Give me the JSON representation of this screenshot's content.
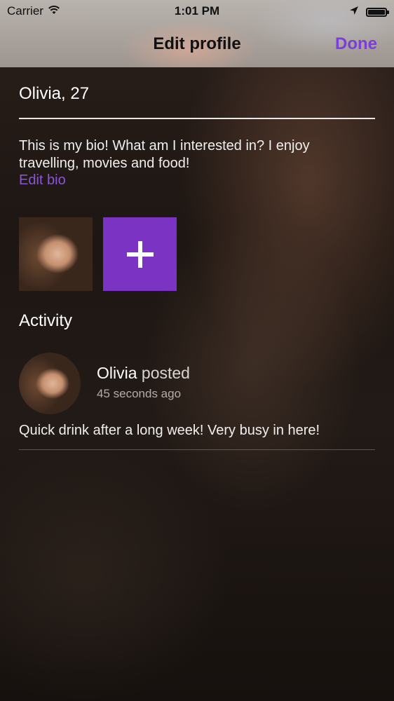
{
  "status_bar": {
    "carrier": "Carrier",
    "time": "1:01 PM"
  },
  "nav": {
    "title": "Edit profile",
    "done_label": "Done"
  },
  "profile": {
    "name_age": "Olivia, 27",
    "bio": "This is my bio! What am I interested in? I enjoy travelling, movies and food!",
    "edit_bio_label": "Edit bio"
  },
  "activity": {
    "title": "Activity",
    "posts": [
      {
        "author": "Olivia",
        "action": "posted",
        "time": "45 seconds ago",
        "text": "Quick drink after a long week! Very busy in here!"
      }
    ]
  },
  "colors": {
    "accent": "#7b33c4",
    "link": "#8a55d8"
  },
  "icons": {
    "status_left": [
      "wifi-icon"
    ],
    "status_right": [
      "location-arrow-icon",
      "battery-icon"
    ],
    "add_photo": "plus-icon"
  }
}
